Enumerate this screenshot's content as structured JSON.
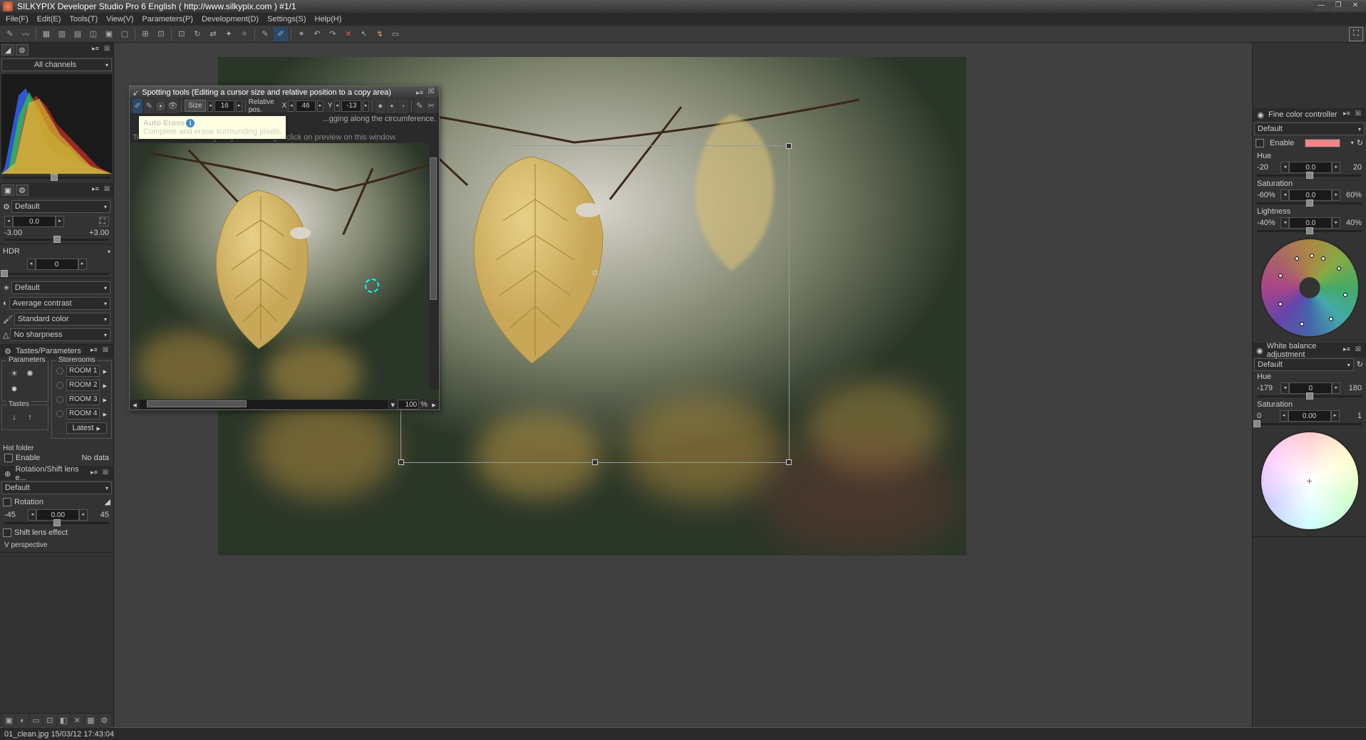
{
  "titlebar": {
    "text": "SILKYPIX Developer Studio Pro 6 English ( http://www.silkypix.com )   #1/1"
  },
  "menu": {
    "items": [
      "File(F)",
      "Edit(E)",
      "Tools(T)",
      "View(V)",
      "Parameters(P)",
      "Development(D)",
      "Settings(S)",
      "Help(H)"
    ]
  },
  "channels": {
    "label": "All channels"
  },
  "left": {
    "exposure": {
      "value": "0.0",
      "min": "-3.00",
      "max": "+3.00"
    },
    "hdr": {
      "label": "HDR",
      "value": "0"
    },
    "default_dd": "Default",
    "contrast_dd": "Average contrast",
    "color_dd": "Standard color",
    "sharpness_dd": "No sharpness",
    "tastes": {
      "header": "Tastes/Parameters",
      "params_legend": "Parameters",
      "storerooms_legend": "Storerooms",
      "tastes_legend": "Tastes",
      "rooms": [
        "ROOM 1",
        "ROOM 2",
        "ROOM 3",
        "ROOM 4"
      ],
      "latest": "Latest"
    },
    "hotfolder": {
      "header": "Hot folder",
      "enable": "Enable",
      "nodata": "No data"
    },
    "rotation": {
      "header": "Rotation/Shift lens e...",
      "default": "Default",
      "rotation_cb": "Rotation",
      "min": "-45",
      "max": "45",
      "value": "0.00",
      "shift_cb": "Shift lens effect",
      "vpersp": "V perspective"
    }
  },
  "spotting": {
    "title": "Spotting tools (Editing a cursor size and relative position to a copy area)",
    "size_label": "Size",
    "size_value": "16",
    "relpos_label": "Relative pos.",
    "x_label": "X",
    "x_value": "46",
    "y_label": "Y",
    "y_value": "-13",
    "hint1": "...gging along the circumference.",
    "hint2": "To exit edit mode, click [Size] button or right-click on preview on this window.",
    "zoom": "100",
    "zoom_unit": "%",
    "tooltip_title": "Auto Erase",
    "tooltip_body": "Complete and erase surrounding pixels."
  },
  "right": {
    "finecolor": {
      "header": "Fine color controller",
      "default": "Default",
      "enable": "Enable",
      "hue": {
        "label": "Hue",
        "min": "-20",
        "max": "20",
        "value": "0.0"
      },
      "sat": {
        "label": "Saturation",
        "min": "-60%",
        "max": "60%",
        "value": "0.0"
      },
      "light": {
        "label": "Lightness",
        "min": "-40%",
        "max": "40%",
        "value": "0.0"
      }
    },
    "wb": {
      "header": "White balance adjustment",
      "default": "Default",
      "hue": {
        "label": "Hue",
        "min": "-179",
        "max": "180",
        "value": "0"
      },
      "sat": {
        "label": "Saturation",
        "min": "0",
        "max": "1",
        "value": "0.00"
      }
    }
  },
  "status": {
    "file": "01_clean.jpg 15/03/12 17:43:04"
  }
}
